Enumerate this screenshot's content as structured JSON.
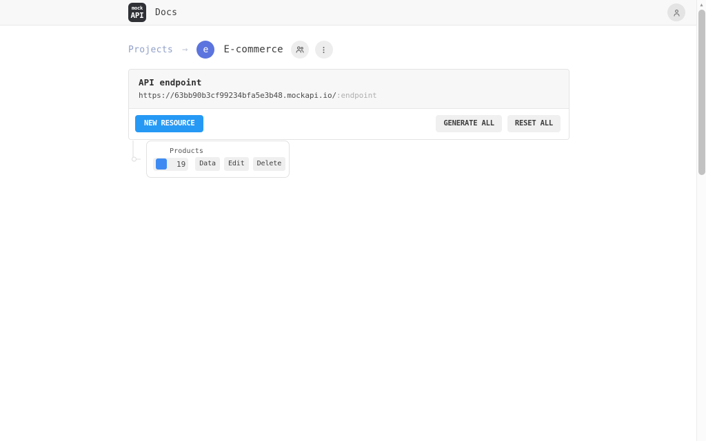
{
  "header": {
    "logo_top": "mock",
    "logo_bottom": "API",
    "docs_label": "Docs",
    "account_icon": "person-icon"
  },
  "breadcrumb": {
    "projects_label": "Projects",
    "arrow": "→",
    "project_initial": "e",
    "project_name": "E-commerce",
    "team_icon": "people-icon",
    "menu_icon": "vertical-dots-icon"
  },
  "endpoint": {
    "title": "API endpoint",
    "url_base": "https://63bb90b3cf99234bfa5e3b48.mockapi.io/",
    "url_param": ":endpoint",
    "new_resource_label": "NEW RESOURCE",
    "generate_all_label": "GENERATE ALL",
    "reset_all_label": "RESET ALL"
  },
  "resources": [
    {
      "name": "Products",
      "count": "19",
      "color": "#3d8bf2",
      "data_label": "Data",
      "edit_label": "Edit",
      "delete_label": "Delete"
    }
  ],
  "colors": {
    "primary_blue": "#2699f5",
    "avatar_indigo": "#5b74de",
    "link_blue": "#90a0c8",
    "swatch_blue": "#3d8bf2"
  }
}
